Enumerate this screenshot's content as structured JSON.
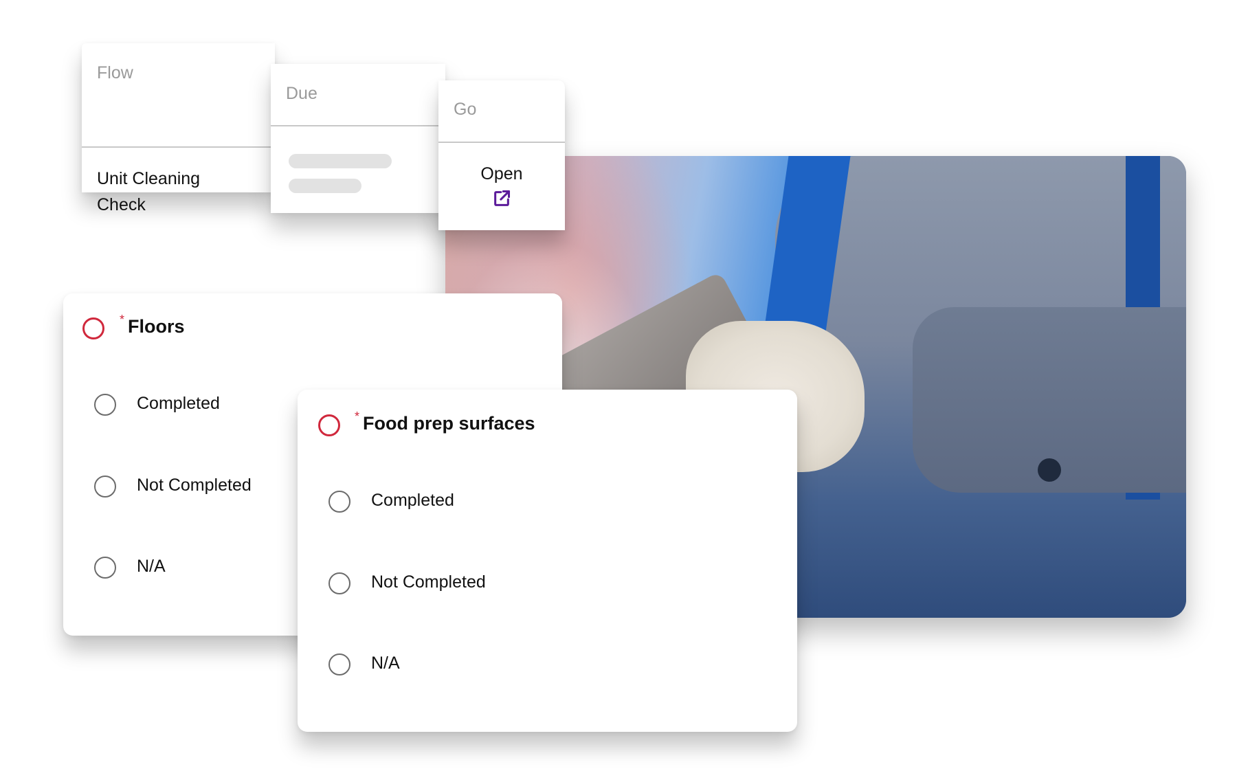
{
  "columns": {
    "flow": {
      "header": "Flow",
      "value": "Unit Cleaning Check"
    },
    "due": {
      "header": "Due",
      "value_placeholder_lines": 2
    },
    "go": {
      "header": "Go",
      "link_label": "Open",
      "link_icon": "external-link-icon",
      "link_color": "#5b1a9a"
    }
  },
  "photo": {
    "description": "Worker in blue-gray uniform and white knit gloves holding a tablet"
  },
  "questions": [
    {
      "title": "Floors",
      "required": true,
      "required_marker": "*",
      "options": [
        "Completed",
        "Not Completed",
        "N/A"
      ]
    },
    {
      "title": "Food prep surfaces",
      "required": true,
      "required_marker": "*",
      "options": [
        "Completed",
        "Not Completed",
        "N/A"
      ]
    }
  ],
  "colors": {
    "required": "#d0283c",
    "accent": "#5b1a9a",
    "header_text": "#9a9a9a"
  }
}
